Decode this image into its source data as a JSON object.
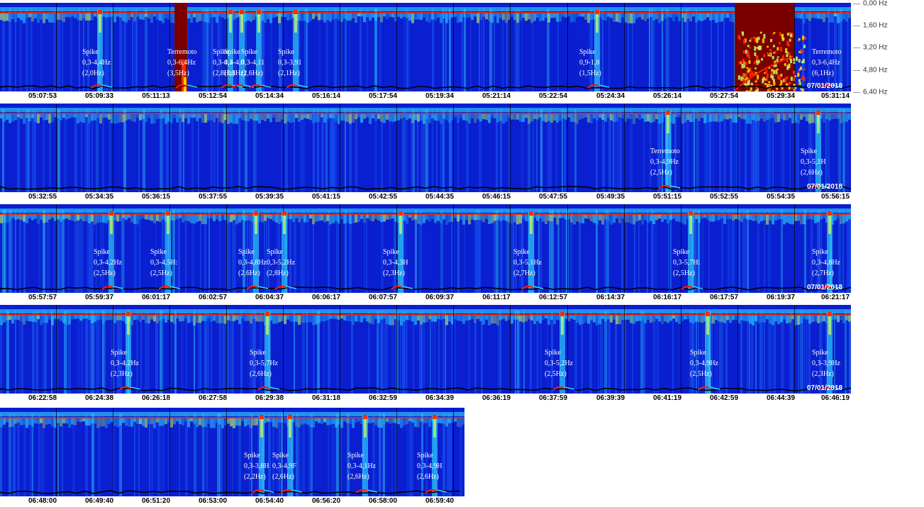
{
  "chart_data": {
    "type": "heatmap",
    "title": "",
    "ylabel": "",
    "y_ticks": [
      "0,00 Hz",
      "1,60 Hz",
      "3,20 Hz",
      "4,80 Hz",
      "6,40 Hz"
    ],
    "ylim": [
      0,
      6.4
    ],
    "colormap": [
      "#0a1fd0",
      "#1e6bff",
      "#2fd8ff",
      "#bff06a",
      "#ffd400",
      "#ff2a00",
      "#7a0000"
    ],
    "rows": [
      {
        "date": "07/01/2018",
        "ticks": [
          "05:07:53",
          "05:09:33",
          "05:11:13",
          "05:12:54",
          "05:14:34",
          "05:16:14",
          "05:17:54",
          "05:19:34",
          "05:21:14",
          "05:22:54",
          "05:24:34",
          "05:26:14",
          "05:27:54",
          "05:29:34",
          "05:31:14"
        ],
        "annotations": [
          {
            "label": "Spike",
            "range": "0,3-4,4Hz",
            "peak": "(2,0Hz)",
            "t": 1.4
          },
          {
            "label": "Terremoto",
            "range": "0,3-6,4Hz",
            "peak": "(3,5Hz)",
            "t": 2.9
          },
          {
            "label": "Spike",
            "range": "0,3-4,4",
            "peak": "(2,8Hz)",
            "t": 3.7
          },
          {
            "label": "Spike",
            "range": "0,3-4,0",
            "peak": "(2,8Hz)",
            "t": 3.9
          },
          {
            "label": "Spike",
            "range": "0,3-4,11",
            "peak": "(2,6Hz)",
            "t": 4.2
          },
          {
            "label": "Spike",
            "range": "0,3-3,91",
            "peak": "(2,1Hz)",
            "t": 4.85
          },
          {
            "label": "Spike",
            "range": "0,9-1,8",
            "peak": "(1,5Hz)",
            "t": 10.15
          },
          {
            "label": "Terremoto",
            "range": "0,3-6,4Hz",
            "peak": "(6,1Hz)",
            "t": 14.25
          }
        ]
      },
      {
        "date": "07/01/2018",
        "ticks": [
          "05:32:55",
          "05:34:35",
          "05:36:15",
          "05:37:55",
          "05:39:35",
          "05:41:15",
          "05:42:55",
          "05:44:35",
          "05:46:15",
          "05:47:55",
          "05:49:35",
          "05:51:15",
          "05:52:55",
          "05:54:35",
          "05:56:15"
        ],
        "annotations": [
          {
            "label": "Terremoto",
            "range": "0,3-4,9Hz",
            "peak": "(2,5Hz)",
            "t": 11.4
          },
          {
            "label": "Spike",
            "range": "0,3-5,1H",
            "peak": "(2,6Hz)",
            "t": 14.05
          }
        ]
      },
      {
        "date": "07/01/2018",
        "ticks": [
          "05:57:57",
          "05:59:37",
          "06:01:17",
          "06:02:57",
          "06:04:37",
          "06:06:17",
          "06:07:57",
          "06:09:37",
          "06:11:17",
          "06:12:57",
          "06:14:37",
          "06:16:17",
          "06:17:57",
          "06:19:37",
          "06:21:17"
        ],
        "annotations": [
          {
            "label": "Spike",
            "range": "0,3-4,2Hz",
            "peak": "(2,5Hz)",
            "t": 1.6
          },
          {
            "label": "Spike",
            "range": "0,3-4,5H:",
            "peak": "(2,5Hz)",
            "t": 2.6
          },
          {
            "label": "Spike",
            "range": "0,3-4,8Hz",
            "peak": "(2,6Hz)",
            "t": 4.15
          },
          {
            "label": "Spike",
            "range": "0,3-5,2Hz",
            "peak": "(2,8Hz)",
            "t": 4.65
          },
          {
            "label": "Spike",
            "range": "0,3-4,3H",
            "peak": "(2,3Hz)",
            "t": 6.7
          },
          {
            "label": "Spike",
            "range": "0,3-5,1Hz",
            "peak": "(2,7Hz)",
            "t": 9.0
          },
          {
            "label": "Spike",
            "range": "0,3-5,7H:",
            "peak": "(2,5Hz)",
            "t": 11.8
          },
          {
            "label": "Spike",
            "range": "0,3-4,8Hz",
            "peak": "(2,7Hz)",
            "t": 14.25
          }
        ]
      },
      {
        "date": "07/01/2018",
        "ticks": [
          "06:22:58",
          "06:24:38",
          "06:26:18",
          "06:27:58",
          "06:29:38",
          "06:31:18",
          "06:32:59",
          "06:34:39",
          "06:36:19",
          "06:37:59",
          "06:39:39",
          "06:41:19",
          "06:42:59",
          "06:44:39",
          "06:46:19"
        ],
        "annotations": [
          {
            "label": "Spike",
            "range": "0,3-4,2Hz",
            "peak": "(2,3Hz)",
            "t": 1.9
          },
          {
            "label": "Spike",
            "range": "0,3-5,7Hz",
            "peak": "(2,6Hz)",
            "t": 4.35
          },
          {
            "label": "Spike",
            "range": "0,3-5,2Hz",
            "peak": "(2,5Hz)",
            "t": 9.55
          },
          {
            "label": "Spike",
            "range": "0,3-4,9Hz",
            "peak": "(2,5Hz)",
            "t": 12.1
          },
          {
            "label": "Spike",
            "range": "0,3-3,9Hz",
            "peak": "(2,3Hz)",
            "t": 14.25
          }
        ]
      },
      {
        "date": "",
        "ticks": [
          "06:48:00",
          "06:49:40",
          "06:51:20",
          "06:53:00",
          "06:54:40",
          "06:56:20",
          "06:58:00",
          "06:59:40"
        ],
        "annotations": [
          {
            "label": "Spike",
            "range": "0,3-3,8H",
            "peak": "(2,2Hz)",
            "t": 4.25
          },
          {
            "label": "Spike",
            "range": "0,3-4,9F",
            "peak": "(2,6Hz)",
            "t": 4.75
          },
          {
            "label": "Spike",
            "range": "0,3-4,1Hz",
            "peak": "(2,6Hz)",
            "t": 6.07
          },
          {
            "label": "Spike",
            "range": "0,3-4,9H",
            "peak": "(2,6Hz)",
            "t": 7.3
          }
        ]
      }
    ]
  }
}
